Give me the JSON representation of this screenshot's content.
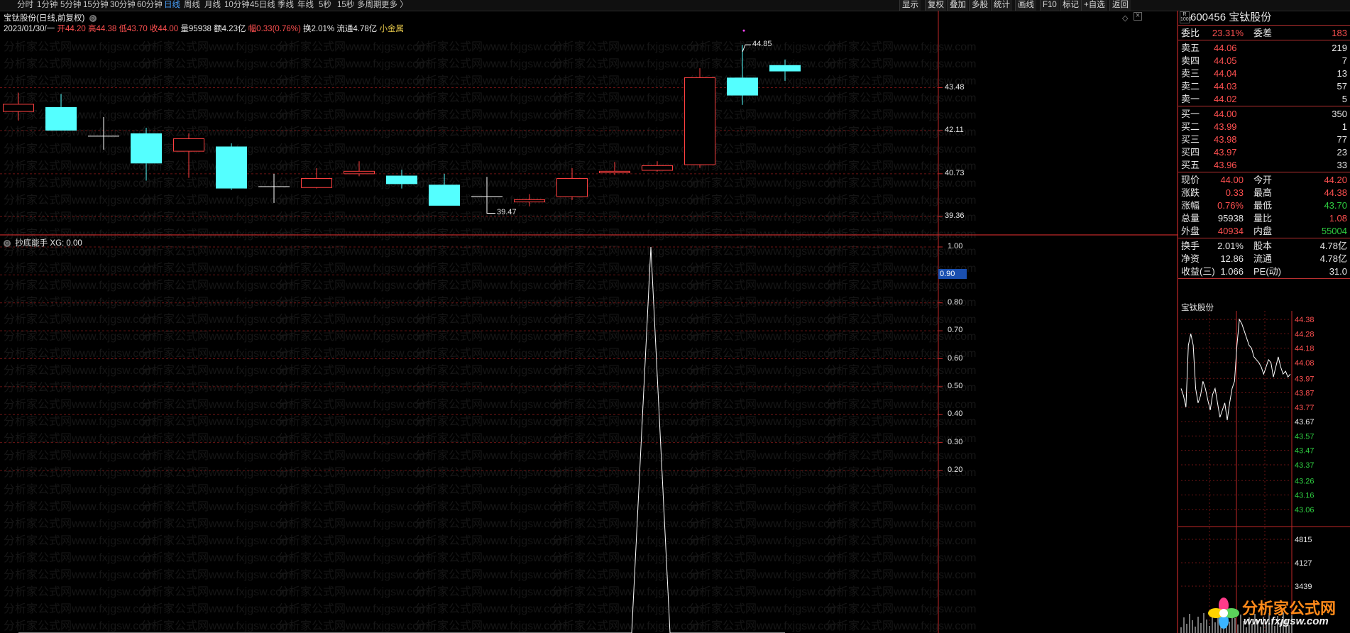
{
  "toolbar": {
    "periods": [
      "分时",
      "1分钟",
      "5分钟",
      "15分钟",
      "30分钟",
      "60分钟",
      "日线",
      "周线",
      "月线",
      "10分钟",
      "45日线",
      "季线",
      "年线",
      "5秒",
      "15秒",
      "多周期",
      "更多 〉"
    ],
    "active_period": "日线",
    "right_buttons": [
      "显示",
      "复权",
      "叠加",
      "多股",
      "统计",
      "画线",
      "F10",
      "标记",
      "+自选",
      "返回"
    ]
  },
  "main_chart": {
    "title": "宝钛股份(日线,前复权)",
    "info": {
      "date": "2023/01/30/一",
      "open": "开44.20",
      "high": "高44.38",
      "low": "低43.70",
      "close": "收44.00",
      "volume": "量95938",
      "amount": "额4.23亿",
      "change": "幅0.33(0.76%)",
      "turnover": "换2.01%",
      "float": "流通4.78亿",
      "sector": "小金属"
    },
    "high_label": "44.85",
    "low_label": "39.47",
    "y_ticks": [
      "43.48",
      "42.11",
      "40.73",
      "39.36"
    ]
  },
  "chart_data": [
    {
      "type": "candlestick",
      "title": "宝钛股份(日线,前复权)",
      "ylim": [
        38.8,
        45.6
      ],
      "y_ticks": [
        43.48,
        42.11,
        40.73,
        39.36
      ],
      "candles": [
        {
          "open": 42.72,
          "close": 42.95,
          "high": 43.32,
          "low": 42.43
        },
        {
          "open": 42.86,
          "close": 42.11,
          "high": 43.28,
          "low": 42.11
        },
        {
          "open": 41.93,
          "close": 41.93,
          "high": 42.54,
          "low": 41.5
        },
        {
          "open": 42.02,
          "close": 41.06,
          "high": 42.2,
          "low": 40.51
        },
        {
          "open": 41.45,
          "close": 41.85,
          "high": 42.02,
          "low": 40.6
        },
        {
          "open": 41.6,
          "close": 40.26,
          "high": 41.7,
          "low": 40.21
        },
        {
          "open": 40.32,
          "close": 40.32,
          "high": 40.73,
          "low": 39.8
        },
        {
          "open": 40.29,
          "close": 40.58,
          "high": 40.91,
          "low": 40.26
        },
        {
          "open": 40.73,
          "close": 40.81,
          "high": 41.13,
          "low": 40.65
        },
        {
          "open": 40.67,
          "close": 40.4,
          "high": 40.86,
          "low": 40.26
        },
        {
          "open": 40.38,
          "close": 39.71,
          "high": 40.73,
          "low": 39.71
        },
        {
          "open": 40.0,
          "close": 40.0,
          "high": 40.63,
          "low": 39.47
        },
        {
          "open": 39.83,
          "close": 39.9,
          "high": 40.08,
          "low": 39.69
        },
        {
          "open": 40.0,
          "close": 40.58,
          "high": 40.91,
          "low": 39.89
        },
        {
          "open": 40.76,
          "close": 40.81,
          "high": 41.11,
          "low": 40.69
        },
        {
          "open": 40.84,
          "close": 40.99,
          "high": 41.13,
          "low": 40.8
        },
        {
          "open": 41.02,
          "close": 43.8,
          "high": 44.1,
          "low": 40.92
        },
        {
          "open": 43.8,
          "close": 43.23,
          "high": 44.85,
          "low": 42.93
        },
        {
          "open": 44.2,
          "close": 44.0,
          "high": 44.38,
          "low": 43.7
        }
      ]
    },
    {
      "type": "line",
      "title": "抄底能手",
      "series": [
        {
          "name": "XG",
          "x": [
            0,
            13.95,
            14.4,
            14.85,
            15.3,
            18
          ],
          "values": [
            0,
            0,
            0,
            1,
            0,
            0
          ]
        }
      ],
      "ylim": [
        0,
        1.0
      ],
      "y_ticks": [
        1.0,
        0.9,
        0.8,
        0.7,
        0.6,
        0.5,
        0.4,
        0.3,
        0.2
      ]
    },
    {
      "type": "line",
      "title": "宝钛股份",
      "ylim": [
        43.0,
        44.42
      ],
      "y_ticks": [
        44.38,
        44.28,
        44.18,
        44.08,
        43.97,
        43.87,
        43.77,
        43.67,
        43.57,
        43.47,
        43.37,
        43.26,
        43.16,
        43.06
      ],
      "volume_ticks": [
        4815,
        4127,
        3439
      ],
      "series": [
        {
          "name": "price",
          "values": [
            43.9,
            43.85,
            43.77,
            44.2,
            44.28,
            44.2,
            43.9,
            43.8,
            43.85,
            43.95,
            43.9,
            43.82,
            43.75,
            43.86,
            43.9,
            43.8,
            43.7,
            43.75,
            43.8,
            43.68,
            43.8,
            43.9,
            43.95,
            44.2,
            44.38,
            44.35,
            44.3,
            44.25,
            44.2,
            44.18,
            44.12,
            44.1,
            44.08,
            44.05,
            44.0,
            44.05,
            44.1,
            44.08,
            43.98,
            44.05,
            44.12,
            44.05,
            44.0,
            44.02,
            43.98,
            44.0
          ]
        }
      ]
    }
  ],
  "indicator": {
    "name": "抄底能手",
    "label": "XG: 0.00",
    "current_value_tag": "0.90",
    "y_ticks": [
      "1.00",
      "0.90",
      "0.80",
      "0.70",
      "0.60",
      "0.50",
      "0.40",
      "0.30",
      "0.20"
    ]
  },
  "quote": {
    "code": "600456",
    "name": "宝钛股份",
    "badge_line1": "R",
    "badge_line2": "1000",
    "webi": {
      "label": "委比",
      "value": "23.31%",
      "label2": "委差",
      "value2": "183"
    },
    "sell": [
      {
        "label": "卖五",
        "price": "44.06",
        "vol": "219"
      },
      {
        "label": "卖四",
        "price": "44.05",
        "vol": "7"
      },
      {
        "label": "卖三",
        "price": "44.04",
        "vol": "13"
      },
      {
        "label": "卖二",
        "price": "44.03",
        "vol": "57"
      },
      {
        "label": "卖一",
        "price": "44.02",
        "vol": "5"
      }
    ],
    "buy": [
      {
        "label": "买一",
        "price": "44.00",
        "vol": "350"
      },
      {
        "label": "买二",
        "price": "43.99",
        "vol": "1"
      },
      {
        "label": "买三",
        "price": "43.98",
        "vol": "77"
      },
      {
        "label": "买四",
        "price": "43.97",
        "vol": "23"
      },
      {
        "label": "买五",
        "price": "43.96",
        "vol": "33"
      }
    ],
    "stats": [
      {
        "l1": "现价",
        "v1": "44.00",
        "l2": "今开",
        "v2": "44.20"
      },
      {
        "l1": "涨跌",
        "v1": "0.33",
        "l2": "最高",
        "v2": "44.38"
      },
      {
        "l1": "涨幅",
        "v1": "0.76%",
        "l2": "最低",
        "v2": "43.70"
      },
      {
        "l1": "总量",
        "v1": "95938",
        "l2": "量比",
        "v2": "1.08"
      },
      {
        "l1": "外盘",
        "v1": "40934",
        "l2": "内盘",
        "v2": "55004"
      }
    ],
    "stats2": [
      {
        "l1": "换手",
        "v1": "2.01%",
        "l2": "股本",
        "v2": "4.78亿"
      },
      {
        "l1": "净资",
        "v1": "12.86",
        "l2": "流通",
        "v2": "4.78亿"
      },
      {
        "l1": "收益(三)",
        "v1": "1.066",
        "l2": "PE(动)",
        "v2": "31.0"
      }
    ]
  },
  "mini_chart": {
    "title": "宝钛股份",
    "price_ticks": [
      "44.38",
      "44.28",
      "44.18",
      "44.08",
      "43.97",
      "43.87",
      "43.77",
      "43.67",
      "43.57",
      "43.47",
      "43.37",
      "43.26",
      "43.16",
      "43.06"
    ],
    "volume_ticks": [
      "4815",
      "4127",
      "3439"
    ]
  },
  "watermark": "分析家公式网www.fxjgsw.com",
  "logo": {
    "text": "分析家公式网",
    "url": "www.fxjgsw.com"
  },
  "colors": {
    "up": "#ff4040",
    "down": "#54ffff",
    "grid": "#6a1414",
    "neutral": "#ffffff",
    "text_red": "#ff5050",
    "text_green": "#2ecc40"
  }
}
